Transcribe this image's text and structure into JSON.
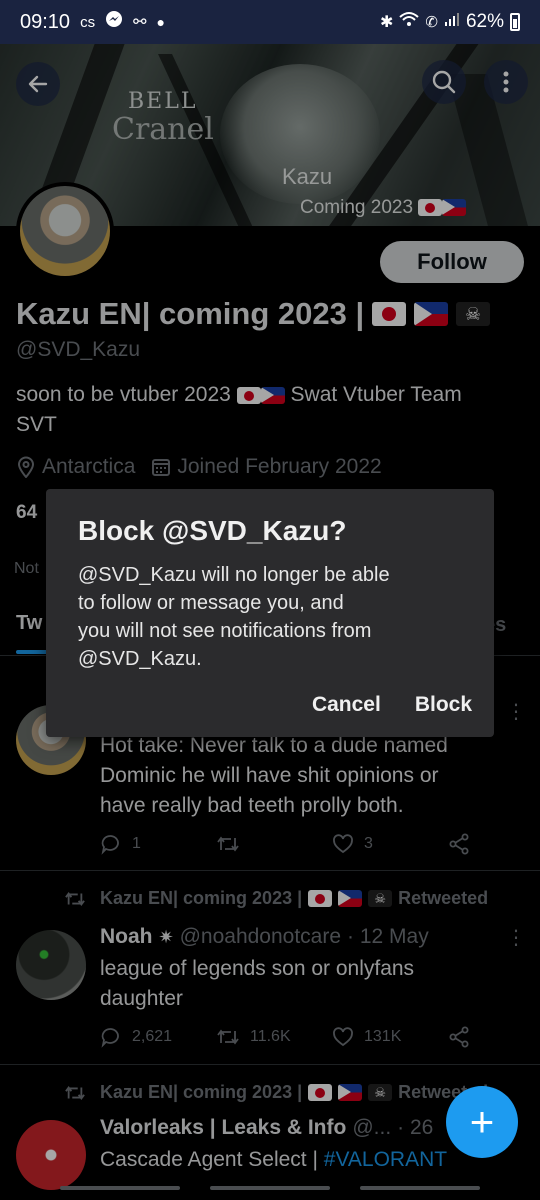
{
  "status_bar": {
    "time": "09:10",
    "carrier": "ᴄs",
    "battery": "62%"
  },
  "banner": {
    "bell_text": "BELL",
    "cranel_text": "Cranel",
    "overlay_name": "Kazu",
    "overlay_sub": "Coming 2023"
  },
  "profile": {
    "name": "Kazu EN| coming 2023 |",
    "handle": "@SVD_Kazu",
    "bio_line1": "soon to be vtuber 2023",
    "bio_line1_after": "Swat Vtuber Team",
    "bio_line2": "SVT",
    "location": "Antarctica",
    "joined": "Joined February 2022",
    "follow_label": "Follow",
    "count_peek": "64",
    "not_peek": "Not"
  },
  "tabs": {
    "first_peek": "Tw",
    "last_peek": "es"
  },
  "dialog": {
    "title": "Block @SVD_Kazu?",
    "body_1": "@SVD_Kazu will no longer be able",
    "body_2": "to follow or message you, and",
    "body_3": "you will not see notifications from",
    "body_4": "@SVD_Kazu.",
    "cancel": "Cancel",
    "confirm": "Block"
  },
  "tweets": [
    {
      "text_1": "Hot take: Never talk to a dude named",
      "text_2": "Dominic he will have shit opinions or",
      "text_3": "have really bad teeth prolly both.",
      "replies": "1",
      "retweets": "",
      "likes": "3"
    },
    {
      "retweeted_by": "Kazu EN| coming 2023 |",
      "retweeted_suffix": "Retweeted",
      "author": "Noah",
      "handle": "@noahdonotcare",
      "date": "· 12 May",
      "text_1": "league of legends son or onlyfans",
      "text_2": "daughter",
      "replies": "2,621",
      "retweets": "11.6K",
      "likes": "131K"
    },
    {
      "retweeted_by": "Kazu EN| coming 2023 |",
      "retweeted_suffix": "Retweeted",
      "author": "Valorleaks | Leaks & Info",
      "handle": "@...",
      "date": "· 26",
      "text_1": "Cascade Agent Select |",
      "hashtag": "#VALORANT"
    }
  ],
  "colors": {
    "accent": "#1d9bf0",
    "background": "#000000",
    "dialog": "#2b2b2d"
  }
}
